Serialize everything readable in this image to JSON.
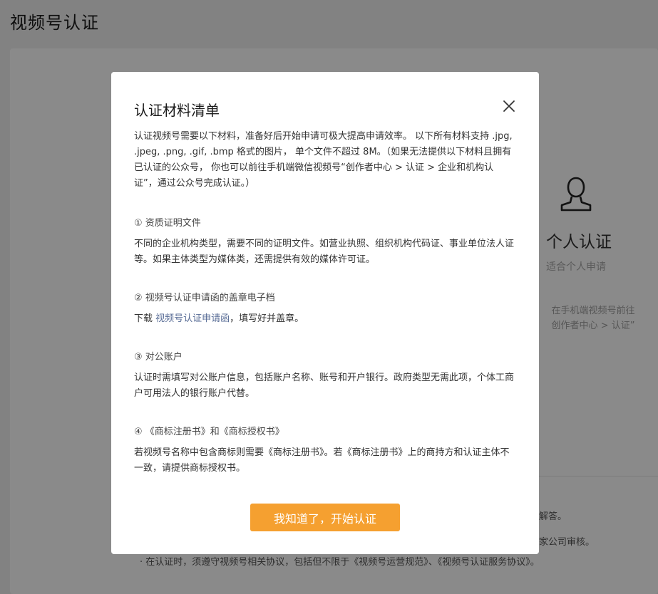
{
  "page": {
    "title": "视频号认证"
  },
  "background": {
    "personal": {
      "title": "个人认证",
      "subtitle": "适合个人申请",
      "desc_line1": "在手机端视频号前往",
      "desc_line2": "创作者中心 > 认证”"
    },
    "notes": {
      "line1": "解答。",
      "line2": "家公司审核。",
      "bottom": "· 在认证时，须遵守视频号相关协议，包括但不限于《视频号运营规范》、《视频号认证服务协议》。"
    }
  },
  "modal": {
    "title": "认证材料清单",
    "intro": "认证视频号需要以下材料，准备好后开始申请可极大提高申请效率。 以下所有材料支持 .jpg, .jpeg, .png, .gif, .bmp 格式的图片， 单个文件不超过 8M。（如果无法提供以下材料且拥有已认证的公众号， 你也可以前往手机端微信视频号“创作者中心 > 认证 > 企业和机构认证”，通过公众号完成认证。）",
    "sections": [
      {
        "head": "① 资质证明文件",
        "text": "不同的企业机构类型，需要不同的证明文件。如营业执照、组织机构代码证、事业单位法人证等。如果主体类型为媒体类，还需提供有效的媒体许可证。"
      },
      {
        "head": "② 视频号认证申请函的盖章电子档",
        "text_prefix": "下载 ",
        "link": "视频号认证申请函",
        "text_suffix": "，填写好并盖章。"
      },
      {
        "head": "③ 对公账户",
        "text": "认证时需填写对公账户信息，包括账户名称、账号和开户银行。政府类型无需此项，个体工商户可用法人的银行账户代替。"
      },
      {
        "head": "④ 《商标注册书》和《商标授权书》",
        "text": "若视频号名称中包含商标则需要《商标注册书》。若《商标注册书》上的商持方和认证主体不一致，请提供商标授权书。"
      }
    ],
    "confirm_label": "我知道了，开始认证"
  },
  "icons": {
    "close": "close-icon",
    "person": "person-icon"
  },
  "colors": {
    "accent": "#f5a030",
    "link": "#576b95",
    "mask": "rgba(0,0,0,0.46)"
  }
}
